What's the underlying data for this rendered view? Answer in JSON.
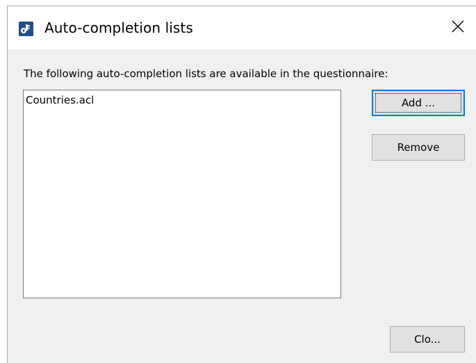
{
  "window": {
    "title": "Auto-completion lists",
    "icon": "app-key-icon",
    "close_icon": "close-icon"
  },
  "instructions": "The following auto-completion lists are available in the questionnaire:",
  "list": {
    "items": [
      "Countries.acl"
    ]
  },
  "buttons": {
    "add_label": "Add ...",
    "remove_label": "Remove",
    "close_label": "Clo..."
  },
  "colors": {
    "dialog_bg": "#f0f0f0",
    "titlebar_bg": "#ffffff",
    "accent": "#0078d7",
    "button_bg": "#e1e1e1"
  }
}
